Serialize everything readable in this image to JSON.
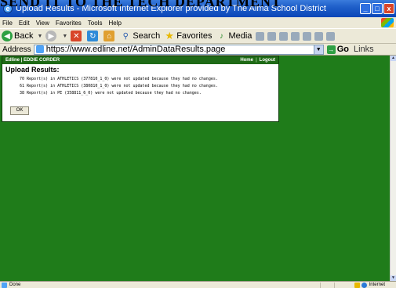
{
  "overlay_caption": "SEND IT TO THE TECH DEPARTMENT",
  "window": {
    "title": "Upload Results - Microsoft Internet Explorer provided by The Alma School District",
    "buttons": [
      "_",
      "□",
      "x"
    ]
  },
  "menu": [
    "File",
    "Edit",
    "View",
    "Favorites",
    "Tools",
    "Help"
  ],
  "toolbar": {
    "back": "Back",
    "search": "Search",
    "favorites": "Favorites",
    "media": "Media"
  },
  "address": {
    "label": "Address",
    "url": "https://www.edline.net/AdminDataResults.page",
    "go": "Go",
    "links": "Links"
  },
  "page": {
    "header_user": "Edline | EDDIE CORDER",
    "nav_home": "Home",
    "nav_sep": "|",
    "nav_logout": "Logout",
    "heading": "Upload Results:",
    "reports": [
      "70 Report(s) in ATHLETICS (377810_1_0) were not updated because they had no changes.",
      "61 Report(s) in ATHLETICS (380810_1_0) were not updated because they had no changes.",
      "38 Report(s) in PE (358811_6_0) were not updated because they had no changes."
    ],
    "ok_button": "OK"
  },
  "status": {
    "text": "Done",
    "zone": "Internet"
  },
  "colors": {
    "page_background": "#1f7c1a",
    "header_bar": "#1f6a16",
    "titlebar": "#0a46b8"
  }
}
